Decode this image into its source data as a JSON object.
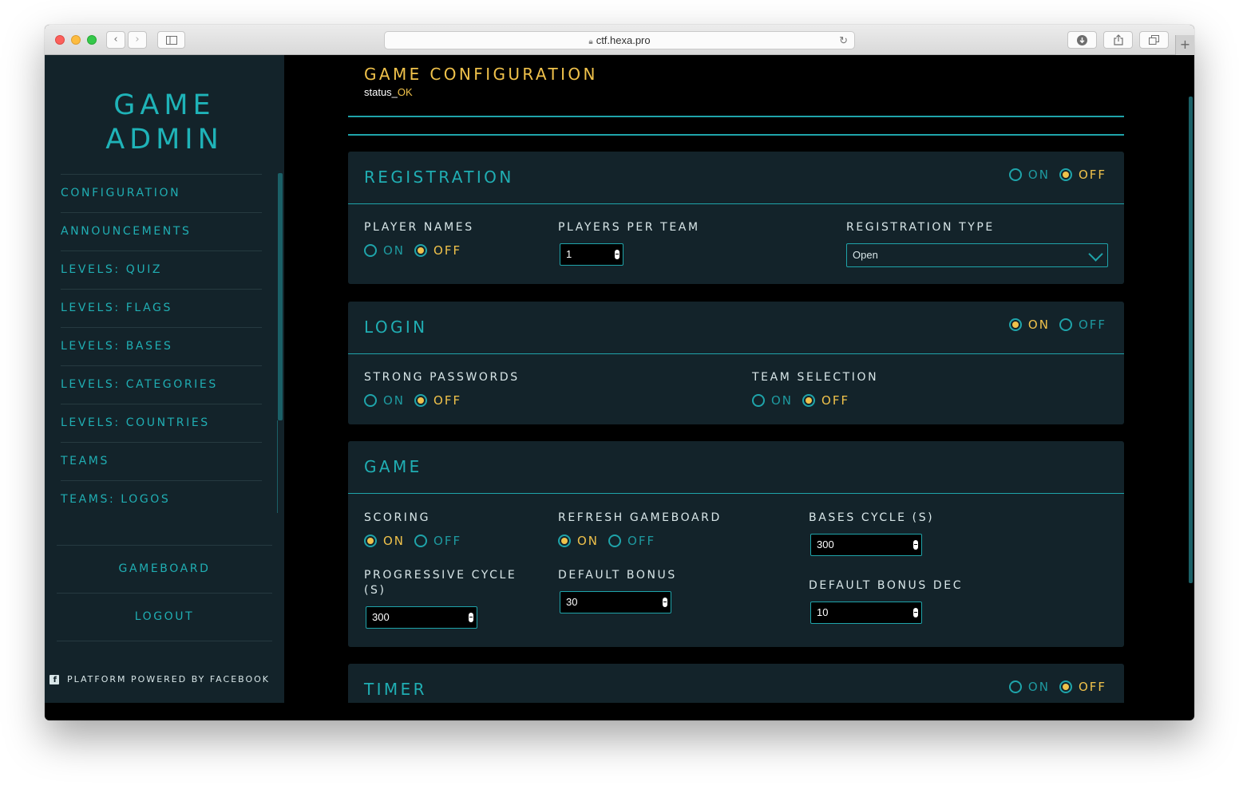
{
  "browser": {
    "url": "ctf.hexa.pro"
  },
  "sidebar": {
    "brand_line1": "GAME",
    "brand_line2": "ADMIN",
    "nav": [
      {
        "label": "CONFIGURATION"
      },
      {
        "label": "ANNOUNCEMENTS"
      },
      {
        "label": "LEVELS: QUIZ"
      },
      {
        "label": "LEVELS: FLAGS"
      },
      {
        "label": "LEVELS: BASES"
      },
      {
        "label": "LEVELS: CATEGORIES"
      },
      {
        "label": "LEVELS: COUNTRIES"
      },
      {
        "label": "TEAMS"
      },
      {
        "label": "TEAMS: LOGOS"
      }
    ],
    "gameboard": "GAMEBOARD",
    "logout": "LOGOUT",
    "powered_by": "PLATFORM POWERED BY FACEBOOK"
  },
  "page": {
    "title": "GAME CONFIGURATION",
    "status_prefix": "status_",
    "status_value": "OK"
  },
  "labels": {
    "on": "ON",
    "off": "OFF"
  },
  "registration": {
    "title": "REGISTRATION",
    "enabled": "OFF",
    "player_names": {
      "label": "PLAYER NAMES",
      "value": "OFF"
    },
    "players_per_team": {
      "label": "PLAYERS PER TEAM",
      "value": "1"
    },
    "registration_type": {
      "label": "REGISTRATION TYPE",
      "value": "Open"
    }
  },
  "login": {
    "title": "LOGIN",
    "enabled": "ON",
    "strong_passwords": {
      "label": "STRONG PASSWORDS",
      "value": "OFF"
    },
    "team_selection": {
      "label": "TEAM SELECTION",
      "value": "OFF"
    }
  },
  "game": {
    "title": "GAME",
    "scoring": {
      "label": "SCORING",
      "value": "ON"
    },
    "refresh_gameboard": {
      "label": "REFRESH GAMEBOARD",
      "value": "ON"
    },
    "bases_cycle": {
      "label": "BASES CYCLE (S)",
      "value": "300"
    },
    "progressive_cycle": {
      "label": "PROGRESSIVE CYCLE (S)",
      "value": "300"
    },
    "default_bonus": {
      "label": "DEFAULT BONUS",
      "value": "30"
    },
    "default_bonus_dec": {
      "label": "DEFAULT BONUS DEC",
      "value": "10"
    }
  },
  "timer": {
    "title": "TIMER",
    "enabled": "OFF"
  },
  "colors": {
    "accent_teal": "#20aeb3",
    "accent_yellow": "#f0c24b",
    "panel_bg": "#13232a",
    "page_bg": "#000000"
  }
}
